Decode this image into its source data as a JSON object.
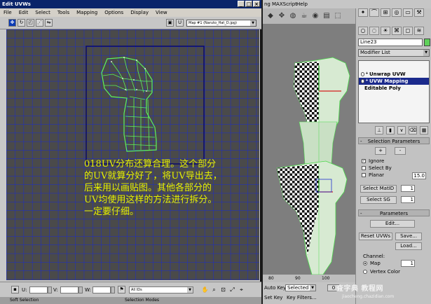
{
  "uvw_window": {
    "title": "Edit UVWs",
    "menu": [
      "File",
      "Edit",
      "Select",
      "Tools",
      "Mapping",
      "Options",
      "Display",
      "View"
    ],
    "texture_dropdown": "Map #1 (Naruto_Hat_D.jpg)",
    "annotation": {
      "lines": [
        "018UV分布还算合理。这个部分",
        "的UV就算分好了，将UV导出去，",
        "后来用以画贴图。其他各部分的",
        "UV均使用这样的方法进行拆分。",
        "一定要仔细。"
      ],
      "color": "#e6f000"
    },
    "bottom": {
      "u_label": "U:",
      "v_label": "V:",
      "w_label": "W:",
      "id_dropdown": "All IDs"
    },
    "status": {
      "soft_selection": "Soft Selection",
      "selection_modes": "Selection Modes"
    }
  },
  "max": {
    "menu": [
      "ng",
      "MAXScript",
      "Help"
    ],
    "view_label": "View",
    "ruler_ticks": [
      "80",
      "90",
      "100"
    ],
    "anim": {
      "auto_key": "Auto Key",
      "selected": "Selected",
      "set_key": "Set Key",
      "key_filters": "Key Filters...",
      "frame": "0"
    }
  },
  "command_panel": {
    "object_name": "Line23",
    "modifier_list": "Modifier List",
    "stack": [
      "Unwrap UVW",
      "UVW Mapping",
      "Editable Poly"
    ],
    "selection_rollout": {
      "title": "Selection Parameters",
      "plus": "+",
      "minus": "-",
      "ignore": "Ignore",
      "select_by": "Select By",
      "planar": "Planar",
      "planar_value": "15.0",
      "select_matid": "Select MatID",
      "select_sg": "Select SG",
      "matid_value": "1",
      "sg_value": "1"
    },
    "parameters_rollout": {
      "title": "Parameters",
      "edit": "Edit...",
      "reset_uvws": "Reset UVWs",
      "save": "Save...",
      "load": "Load...",
      "channel": "Channel:",
      "map": "Map",
      "map_value": "1",
      "vertex_color": "Vertex Color"
    }
  },
  "watermark": {
    "main": "查字典 教程网",
    "sub": "jiaocheng.chazidian.com"
  },
  "colors": {
    "uv_grid": "#1a2bd0",
    "uv_wire": "#5cf25c",
    "selected_stack": "#1b2a8c",
    "object_color": "#5fd15a",
    "annotation": "#e6f000"
  }
}
